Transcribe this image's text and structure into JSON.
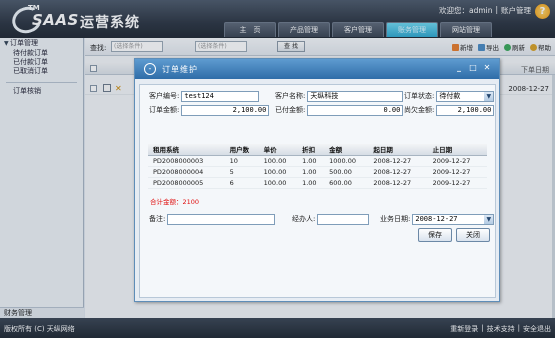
{
  "header": {
    "logo": {
      "tm": "TM",
      "saas": "SAAS",
      "name": "运营系统"
    },
    "user": {
      "greeting": "欢迎您：admin",
      "sep": "|",
      "account": "账户管理"
    },
    "help_icon": "?",
    "nav": [
      {
        "label": "主　页"
      },
      {
        "label": "产品管理"
      },
      {
        "label": "客户管理"
      },
      {
        "label": "账务管理",
        "active": true
      },
      {
        "label": "网站管理"
      }
    ]
  },
  "sidebar": {
    "group_order": "订单管理",
    "items": [
      "待付款订单",
      "已付款订单",
      "已取消订单"
    ],
    "verify": "订单核销",
    "group_finance": "财务管理"
  },
  "main": {
    "filter_label": "查找:",
    "filter_select_1": "(选择条件)",
    "filter_select_2": "(选择条件)",
    "filter_button": "查 找",
    "actions": [
      "新增",
      "导出",
      "刷新",
      "帮助"
    ],
    "col_date": "下单日期",
    "row_date": "2008-12-27"
  },
  "footer": {
    "copyright": "版权所有 (C) 天纵网络",
    "links": [
      "重新登录",
      "|",
      "技术支持",
      "|",
      "安全退出"
    ]
  },
  "modal": {
    "title": "订单维护",
    "icon": "-",
    "window_buttons": [
      "_",
      "□",
      "✕"
    ],
    "form": {
      "order_no_label": "客户编号:",
      "order_no": "test124",
      "customer_label": "客户名称:",
      "customer": "天纵科技",
      "status_label": "订单状态:",
      "status": "待付款",
      "amount_label": "订单金额:",
      "amount": "2,100.00",
      "paid_label": "已付金额:",
      "paid": "0.00",
      "owed_label": "尚欠金额:",
      "owed": "2,100.00"
    },
    "table": {
      "headers": [
        "租用系统",
        "用户数",
        "单价",
        "折扣",
        "金额",
        "起日期",
        "止日期"
      ],
      "rows": [
        [
          "PD2008000003",
          "10",
          "100.00",
          "1.00",
          "1000.00",
          "2008-12-27",
          "2009-12-27"
        ],
        [
          "PD2008000004",
          "5",
          "100.00",
          "1.00",
          "500.00",
          "2008-12-27",
          "2009-12-27"
        ],
        [
          "PD2008000005",
          "6",
          "100.00",
          "1.00",
          "600.00",
          "2008-12-27",
          "2009-12-27"
        ]
      ]
    },
    "total": "合计金额：2100",
    "bottom": {
      "remark_label": "备注:",
      "remark": "",
      "handler_label": "经办人:",
      "handler": "",
      "biz_date_label": "业务日期:",
      "biz_date": "2008-12-27"
    },
    "save_label": "保存",
    "close_label": "关闭"
  },
  "colors": {
    "header_bg": "#2c3542",
    "active_tab": "#2fa8cf",
    "modal_title": "#2f6da8",
    "total_text": "#e01010"
  }
}
